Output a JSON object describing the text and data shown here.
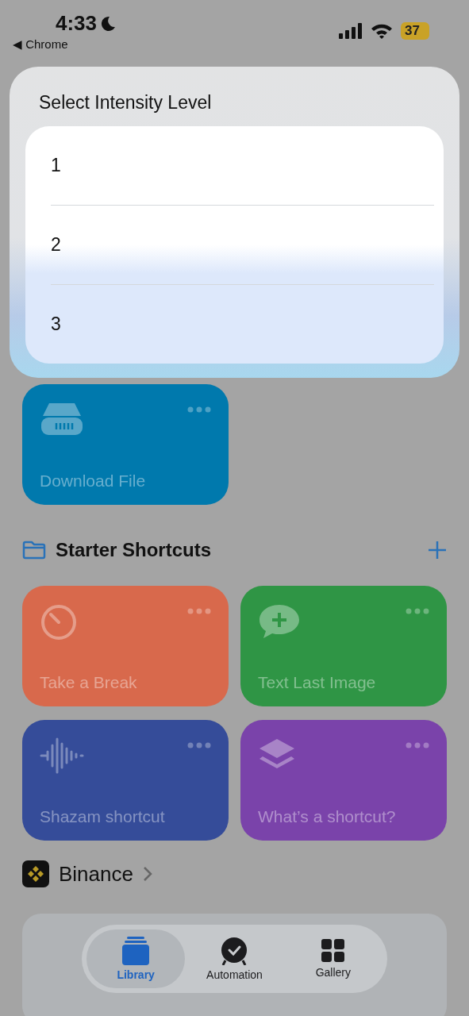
{
  "status_bar": {
    "time": "4:33",
    "back_label": "◀ Chrome",
    "battery": "37"
  },
  "dialog": {
    "title": "Select Intensity Level",
    "options": [
      "1",
      "2",
      "3"
    ]
  },
  "shortcuts": [
    {
      "name": "Download File",
      "color": "#0079ad",
      "kind": "drive"
    }
  ],
  "folder": {
    "title": "Starter Shortcuts",
    "shortcuts": [
      {
        "name": "Take a Break",
        "color": "#d8694c",
        "kind": "timer"
      },
      {
        "name": "Text Last Image",
        "color": "#2f9545",
        "kind": "message"
      },
      {
        "name": "Shazam shortcut",
        "color": "#354c99",
        "kind": "wave"
      },
      {
        "name": "What’s a shortcut?",
        "color": "#7a43aa",
        "kind": "layers"
      }
    ]
  },
  "app_section": {
    "title": "Binance"
  },
  "tabs": [
    {
      "label": "Library",
      "selected": true,
      "kind": "library"
    },
    {
      "label": "Automation",
      "selected": false,
      "kind": "clock"
    },
    {
      "label": "Gallery",
      "selected": false,
      "kind": "grid"
    }
  ]
}
